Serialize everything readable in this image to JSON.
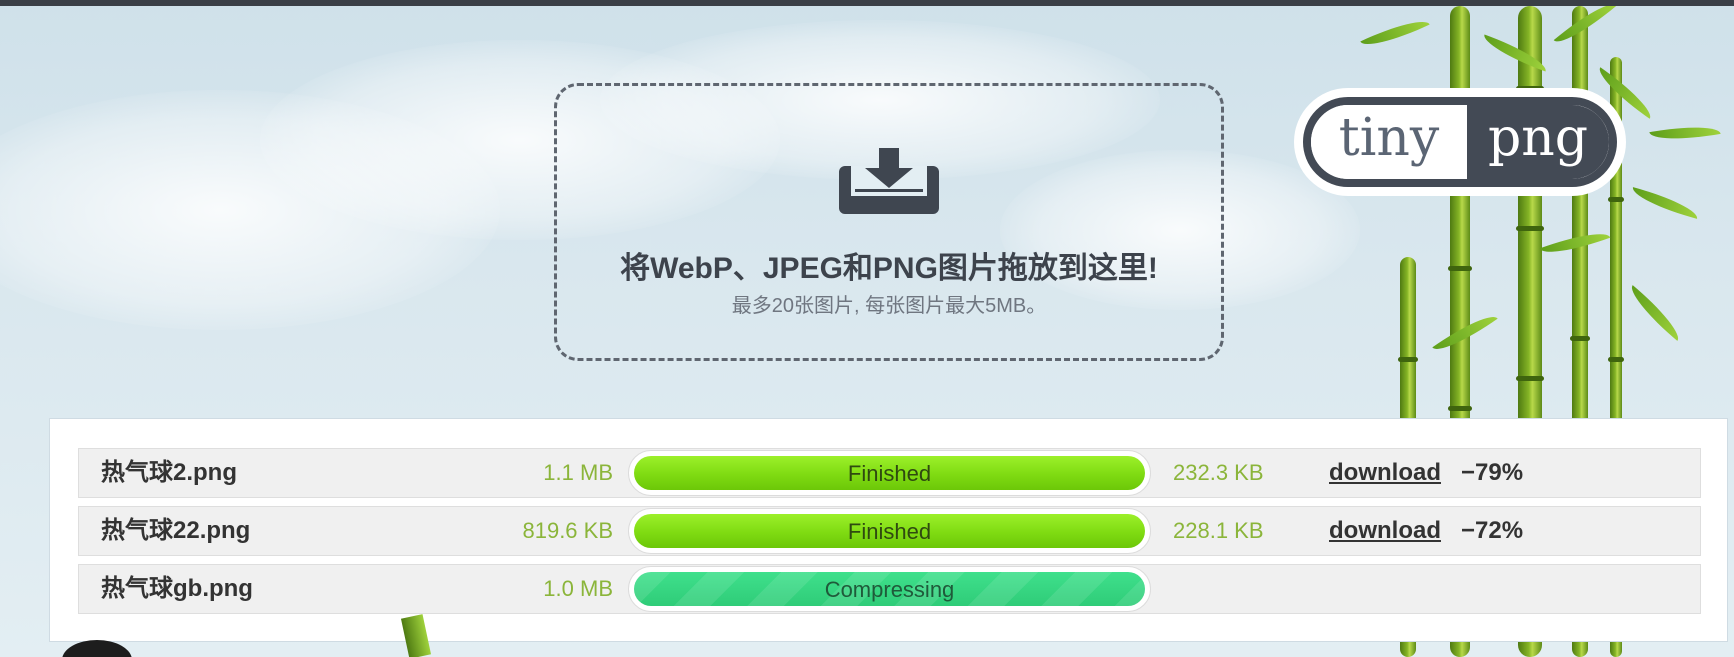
{
  "logo": {
    "left": "tiny",
    "right": "png"
  },
  "dropzone": {
    "icon": "download-tray-icon",
    "title": "将WebP、JPEG和PNG图片拖放到这里!",
    "subtitle": "最多20张图片, 每张图片最大5MB。"
  },
  "files": [
    {
      "name": "热气球2.png",
      "original_size": "1.1 MB",
      "status": "Finished",
      "status_state": "finished",
      "progress": 1.0,
      "new_size": "232.3 KB",
      "download_label": "download",
      "saving": "−79%"
    },
    {
      "name": "热气球22.png",
      "original_size": "819.6 KB",
      "status": "Finished",
      "status_state": "finished",
      "progress": 1.0,
      "new_size": "228.1 KB",
      "download_label": "download",
      "saving": "−72%"
    },
    {
      "name": "热气球gb.png",
      "original_size": "1.0 MB",
      "status": "Compressing",
      "status_state": "compressing",
      "progress": 1.0,
      "new_size": "",
      "download_label": "",
      "saving": ""
    }
  ],
  "colors": {
    "finished_bar": "#7fdb12",
    "compressing_bar": "#2fcc78",
    "size_text": "#8bb53a",
    "logo_dark": "#434a55"
  }
}
